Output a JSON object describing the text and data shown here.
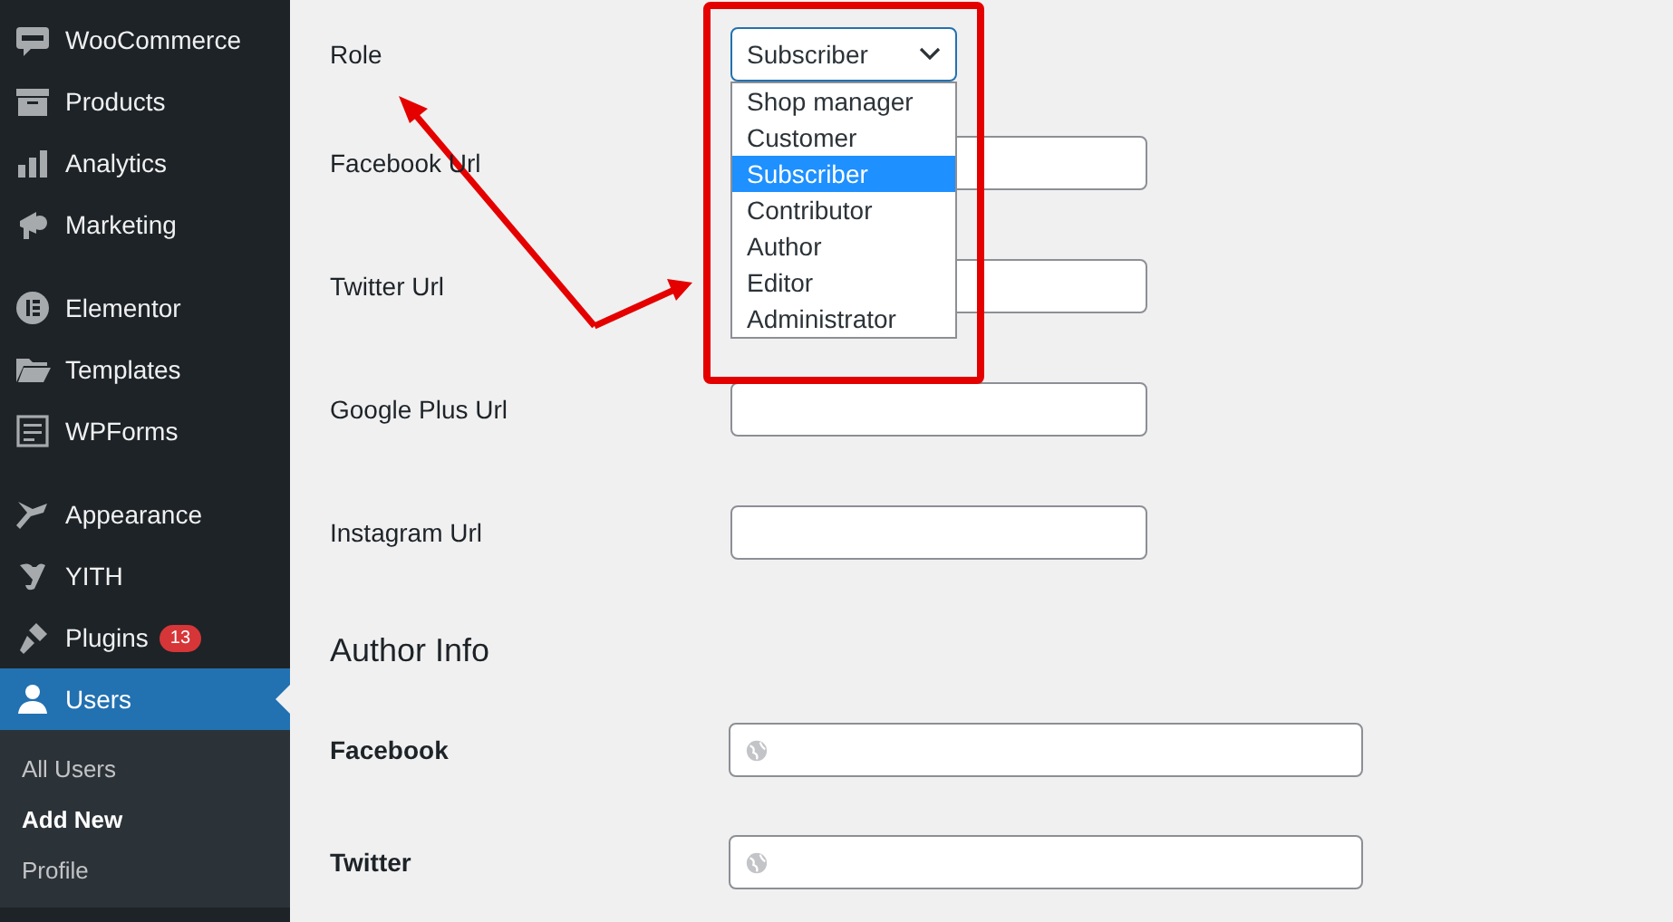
{
  "sidebar": {
    "groups": [
      [
        {
          "label": "WooCommerce",
          "selected": false
        },
        {
          "label": "Products",
          "selected": false
        },
        {
          "label": "Analytics",
          "selected": false
        },
        {
          "label": "Marketing",
          "selected": false
        }
      ],
      [
        {
          "label": "Elementor",
          "selected": false
        },
        {
          "label": "Templates",
          "selected": false
        },
        {
          "label": "WPForms",
          "selected": false
        }
      ],
      [
        {
          "label": "Appearance",
          "selected": false
        },
        {
          "label": "YITH",
          "selected": false
        },
        {
          "label": "Plugins",
          "selected": false,
          "badge": "13"
        },
        {
          "label": "Users",
          "selected": true
        }
      ]
    ],
    "submenu": [
      {
        "label": "All Users",
        "selected": false
      },
      {
        "label": "Add New",
        "selected": true
      },
      {
        "label": "Profile",
        "selected": false
      }
    ]
  },
  "form": {
    "role": {
      "label": "Role",
      "value": "Subscriber",
      "expanded": true,
      "options": [
        {
          "label": "Shop manager",
          "selected": false
        },
        {
          "label": "Customer",
          "selected": false
        },
        {
          "label": "Subscriber",
          "selected": true
        },
        {
          "label": "Contributor",
          "selected": false
        },
        {
          "label": "Author",
          "selected": false
        },
        {
          "label": "Editor",
          "selected": false
        },
        {
          "label": "Administrator",
          "selected": false
        }
      ]
    },
    "fields": [
      {
        "label": "Facebook Url"
      },
      {
        "label": "Twitter Url"
      },
      {
        "label": "Google Plus Url"
      },
      {
        "label": "Instagram Url"
      }
    ],
    "section_title": "Author Info",
    "author_fields": [
      {
        "label": "Facebook"
      },
      {
        "label": "Twitter"
      }
    ]
  }
}
